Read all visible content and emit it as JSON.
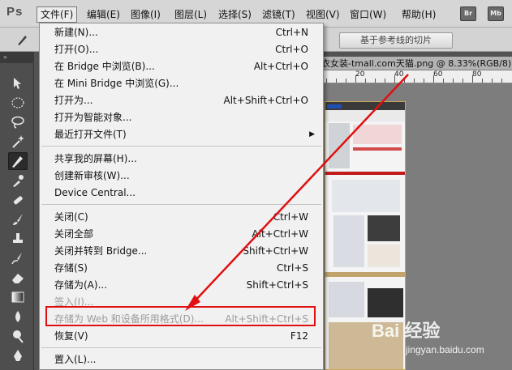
{
  "app": {
    "logo": "Ps"
  },
  "menubar": {
    "items": [
      "文件(F)",
      "编辑(E)",
      "图像(I)",
      "图层(L)",
      "选择(S)",
      "滤镜(T)",
      "视图(V)",
      "窗口(W)",
      "帮助(H)"
    ],
    "bridge_btn": "Br",
    "minibridge_btn": "Mb"
  },
  "options": {
    "slice_btn": "基于参考线的切片"
  },
  "document": {
    "tab_title": "衣女装-tmall.com天猫.png @ 8.33%(RGB/8)",
    "ruler_labels": [
      "20",
      "40",
      "60",
      "80"
    ]
  },
  "file_menu": {
    "items": [
      {
        "label": "新建(N)...",
        "shortcut": "Ctrl+N"
      },
      {
        "label": "打开(O)...",
        "shortcut": "Ctrl+O"
      },
      {
        "label": "在 Bridge 中浏览(B)...",
        "shortcut": "Alt+Ctrl+O"
      },
      {
        "label": "在 Mini Bridge 中浏览(G)...",
        "shortcut": ""
      },
      {
        "label": "打开为...",
        "shortcut": "Alt+Shift+Ctrl+O"
      },
      {
        "label": "打开为智能对象...",
        "shortcut": ""
      },
      {
        "label": "最近打开文件(T)",
        "shortcut": ""
      },
      {
        "label": "共享我的屏幕(H)...",
        "shortcut": ""
      },
      {
        "label": "创建新审核(W)...",
        "shortcut": ""
      },
      {
        "label": "Device Central...",
        "shortcut": ""
      },
      {
        "label": "关闭(C)",
        "shortcut": "Ctrl+W"
      },
      {
        "label": "关闭全部",
        "shortcut": "Alt+Ctrl+W"
      },
      {
        "label": "关闭并转到 Bridge...",
        "shortcut": "Shift+Ctrl+W"
      },
      {
        "label": "存储(S)",
        "shortcut": "Ctrl+S"
      },
      {
        "label": "存储为(A)...",
        "shortcut": "Shift+Ctrl+S"
      },
      {
        "label": "签入(I)...",
        "shortcut": ""
      },
      {
        "label": "存储为 Web 和设备所用格式(D)...",
        "shortcut": "Alt+Shift+Ctrl+S"
      },
      {
        "label": "恢复(V)",
        "shortcut": "F12"
      },
      {
        "label": "置入(L)...",
        "shortcut": ""
      }
    ]
  },
  "watermark": {
    "logo": "Bai  经验",
    "sub": "jingyan.baidu.com"
  },
  "colors": {
    "highlight": "#e01010",
    "arrow": "#e01010"
  }
}
